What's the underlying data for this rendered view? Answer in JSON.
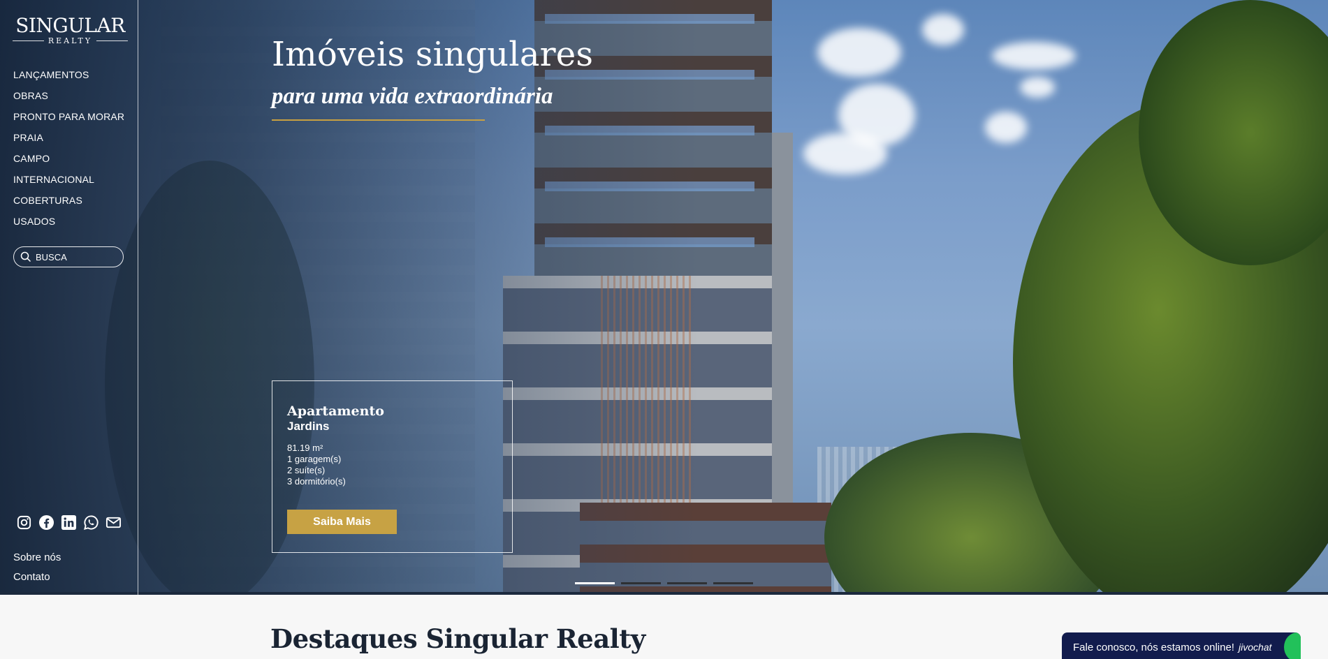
{
  "brand": {
    "name": "SINGULAR",
    "sub": "REALTY"
  },
  "nav": {
    "items": [
      {
        "label": "LANÇAMENTOS"
      },
      {
        "label": "OBRAS"
      },
      {
        "label": "PRONTO PARA MORAR"
      },
      {
        "label": "PRAIA"
      },
      {
        "label": "CAMPO"
      },
      {
        "label": "INTERNACIONAL"
      },
      {
        "label": "COBERTURAS"
      },
      {
        "label": "USADOS"
      }
    ]
  },
  "search": {
    "placeholder": "BUSCA",
    "icon": "search-icon"
  },
  "social": [
    "instagram-icon",
    "facebook-icon",
    "linkedin-icon",
    "whatsapp-icon",
    "email-icon"
  ],
  "footer_links": {
    "about": "Sobre nós",
    "contact": "Contato"
  },
  "hero": {
    "title": "Imóveis singulares",
    "subtitle": "para uma vida extraordinária",
    "accent_color": "#c7a244",
    "card": {
      "type": "Apartamento",
      "location": "Jardins",
      "area": "81.19 m²",
      "garages": "1 garagem(s)",
      "suites": "2 suíte(s)",
      "bedrooms": "3 dormitório(s)",
      "button": "Saiba Mais"
    },
    "slides": {
      "count": 4,
      "active_index": 1
    }
  },
  "highlights": {
    "title": "Destaques Singular Realty"
  },
  "chat": {
    "text": "Fale conosco, nós estamos online!",
    "brand": "jivochat",
    "bg_color": "#121c4d"
  }
}
